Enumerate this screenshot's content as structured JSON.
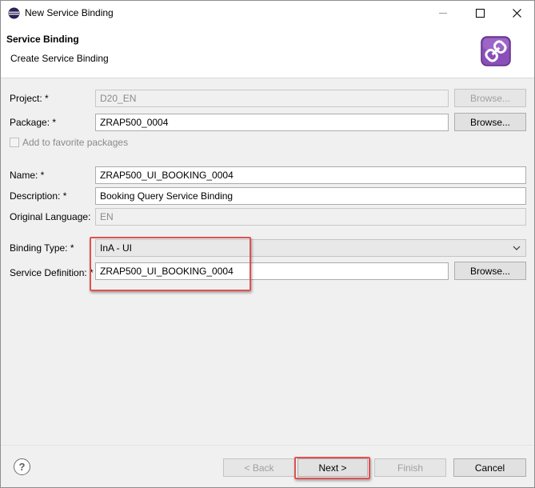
{
  "window": {
    "title": "New Service Binding",
    "controls": {
      "minimize": "—",
      "maximize": "☐",
      "close": "✕"
    }
  },
  "banner": {
    "title": "Service Binding",
    "subtitle": "Create Service Binding",
    "icon": "service-binding-link-icon"
  },
  "form": {
    "project": {
      "label": "Project: *",
      "value": "D20_EN",
      "browse": "Browse..."
    },
    "package": {
      "label": "Package: *",
      "value": "ZRAP500_0004",
      "browse": "Browse..."
    },
    "favorite": {
      "label": "Add to favorite packages",
      "checked": false
    },
    "name": {
      "label": "Name: *",
      "value": "ZRAP500_UI_BOOKING_0004"
    },
    "description": {
      "label": "Description: *",
      "value": "Booking Query Service Binding"
    },
    "original_language": {
      "label": "Original Language:",
      "value": "EN"
    },
    "binding_type": {
      "label": "Binding Type: *",
      "value": "InA - UI"
    },
    "service_definition": {
      "label": "Service Definition: *",
      "value": "ZRAP500_UI_BOOKING_0004",
      "browse": "Browse..."
    }
  },
  "footer": {
    "help": "?",
    "back": "< Back",
    "next": "Next >",
    "finish": "Finish",
    "cancel": "Cancel"
  },
  "colors": {
    "highlight": "#e05151",
    "banner_icon": "#8a4fb8"
  }
}
